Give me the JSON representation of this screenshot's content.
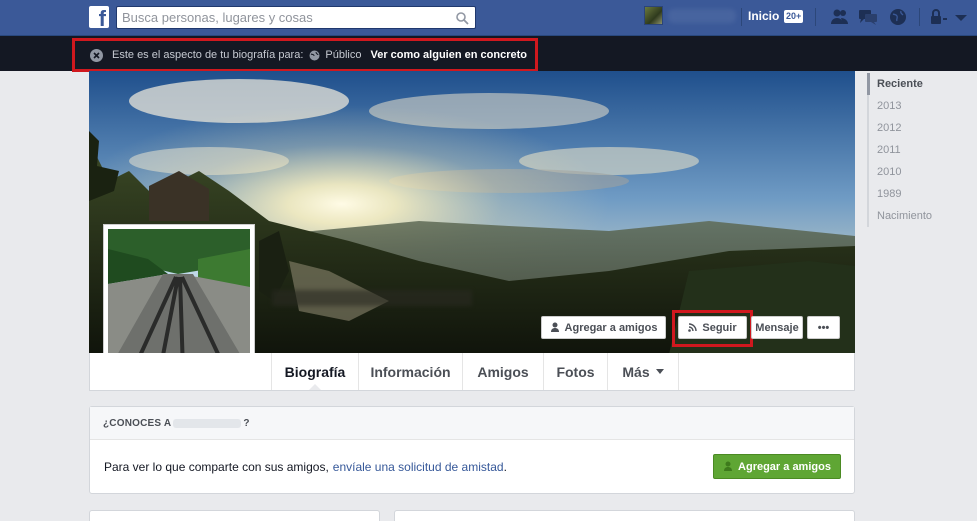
{
  "topbar": {
    "logo": "f",
    "search_placeholder": "Busca personas, lugares y cosas",
    "home_label": "Inicio",
    "home_badge": "20+",
    "icons": [
      "friend-requests-icon",
      "messages-icon",
      "notifications-globe-icon",
      "privacy-lock-icon",
      "settings-arrow-icon"
    ]
  },
  "notice": {
    "text": "Este es el aspecto de tu biografía para:",
    "audience": "Público",
    "view_as_link": "Ver como alguien en concreto"
  },
  "cover_actions": {
    "add_friend": "Agregar a amigos",
    "follow": "Seguir",
    "message": "Mensaje",
    "more": "•••"
  },
  "tabs": [
    {
      "label": "Biografía"
    },
    {
      "label": "Información"
    },
    {
      "label": "Amigos"
    },
    {
      "label": "Fotos"
    },
    {
      "label": "Más"
    }
  ],
  "timeline_years": [
    "Reciente",
    "2013",
    "2012",
    "2011",
    "2010",
    "1989",
    "Nacimiento"
  ],
  "friend_suggestion": {
    "heading_prefix": "¿CONOCES A",
    "heading_suffix": "?",
    "body_text": "Para ver lo que comparte con sus amigos,",
    "link_text": "envíale una solicitud de amistad",
    "body_end": ".",
    "button": "Agregar a amigos"
  },
  "colors": {
    "brand_blue": "#3b5998",
    "notice_bar": "#141823",
    "highlight_red": "#d0181e",
    "green_button": "#5fa634",
    "link_blue": "#365899"
  }
}
